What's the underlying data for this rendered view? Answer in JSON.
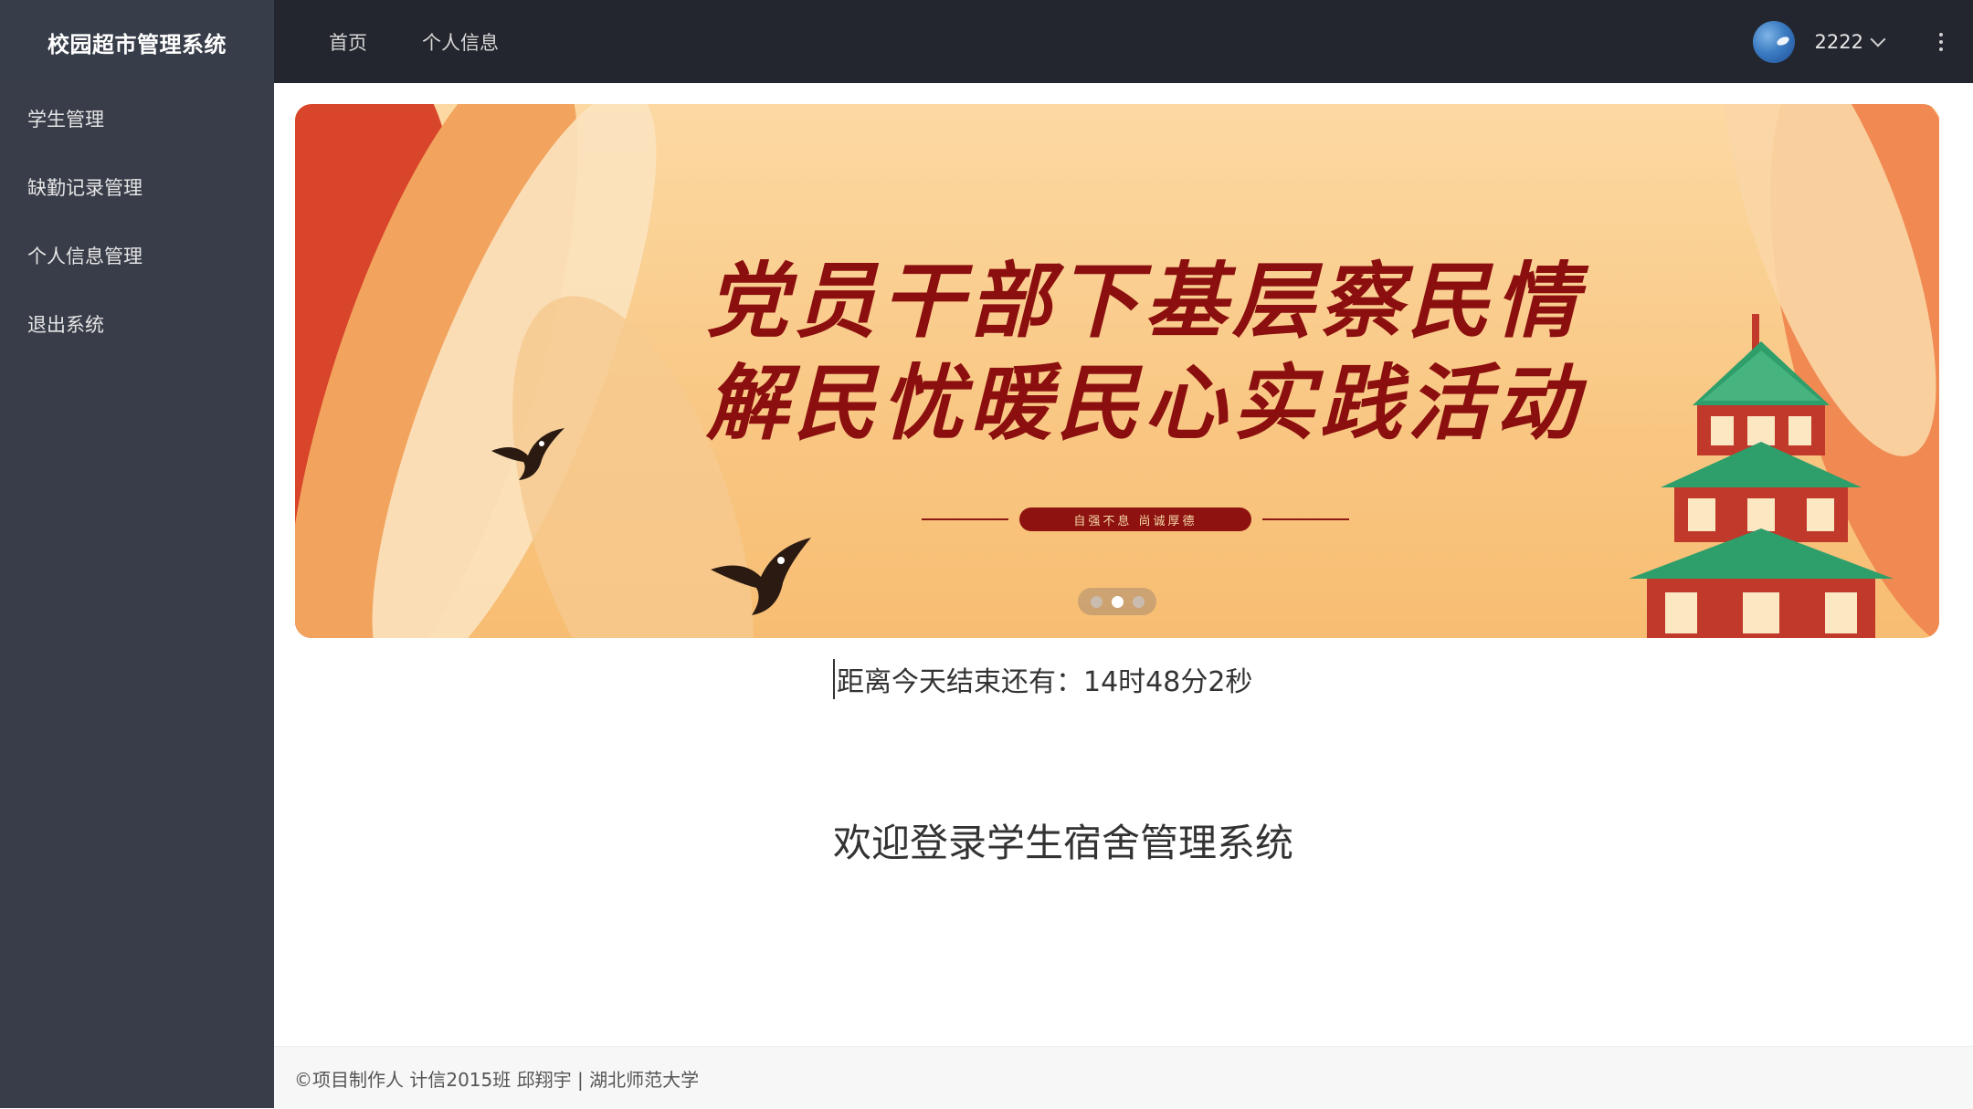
{
  "app": {
    "title": "校园超市管理系统"
  },
  "sidebar": {
    "items": [
      {
        "label": "学生管理"
      },
      {
        "label": "缺勤记录管理"
      },
      {
        "label": "个人信息管理"
      },
      {
        "label": "退出系统"
      }
    ]
  },
  "header": {
    "nav": [
      {
        "label": "首页"
      },
      {
        "label": "个人信息"
      }
    ],
    "user": {
      "name": "2222",
      "avatar_icon": "avatar-icon",
      "menu_icon": "more-vertical-icon"
    }
  },
  "banner": {
    "title_line1": "党员干部下基层察民情",
    "title_line2": "解民忧暖民心实践活动",
    "ribbon_text": "自强不息   尚诚厚德",
    "slides": 3,
    "active_slide": 2
  },
  "main": {
    "countdown": "距离今天结束还有：14时48分2秒",
    "welcome": "欢迎登录学生宿舍管理系统"
  },
  "footer": {
    "text": "©项目制作人 计信2015班 邱翔宇 | 湖北师范大学"
  },
  "colors": {
    "sidebar_bg": "#393d49",
    "header_bg": "#23262e",
    "banner_text": "#8b0f0f"
  }
}
